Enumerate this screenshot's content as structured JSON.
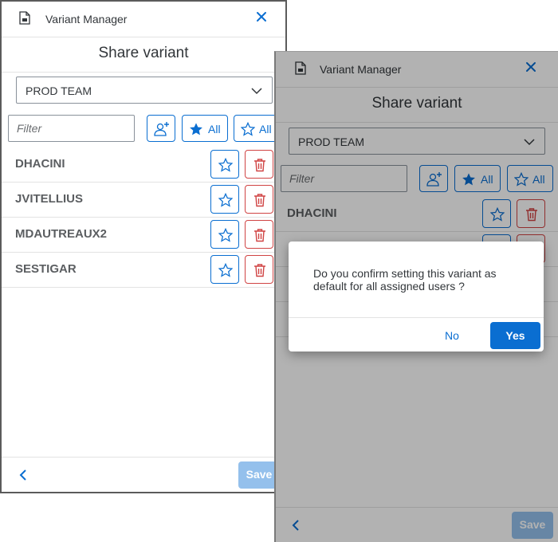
{
  "colors": {
    "accent": "#0a6ed1",
    "danger": "#d04343",
    "save_disabled": "#94c0ec",
    "overlay": "rgba(0,0,0,0.30)"
  },
  "left_panel": {
    "window_title": "Variant Manager",
    "dialog_title": "Share variant",
    "team_select": {
      "value": "PROD TEAM"
    },
    "filter": {
      "placeholder": "Filter",
      "value": ""
    },
    "toolbar": {
      "add_user_icon": "add-user-icon",
      "set_all_label": "All",
      "unset_all_label": "All"
    },
    "users": [
      {
        "name": "DHACINI"
      },
      {
        "name": "JVITELLIUS"
      },
      {
        "name": "MDAUTREAUX2"
      },
      {
        "name": "SESTIGAR"
      }
    ],
    "footer": {
      "save_label": "Save"
    }
  },
  "right_panel": {
    "window_title": "Variant Manager",
    "dialog_title": "Share variant",
    "team_select": {
      "value": "PROD TEAM"
    },
    "filter": {
      "placeholder": "Filter",
      "value": ""
    },
    "toolbar": {
      "set_all_label": "All",
      "unset_all_label": "All"
    },
    "users": [
      {
        "name": "DHACINI"
      }
    ],
    "footer": {
      "save_label": "Save"
    }
  },
  "confirm_dialog": {
    "message": "Do you confirm setting this variant as default for all assigned users ?",
    "no_label": "No",
    "yes_label": "Yes"
  }
}
